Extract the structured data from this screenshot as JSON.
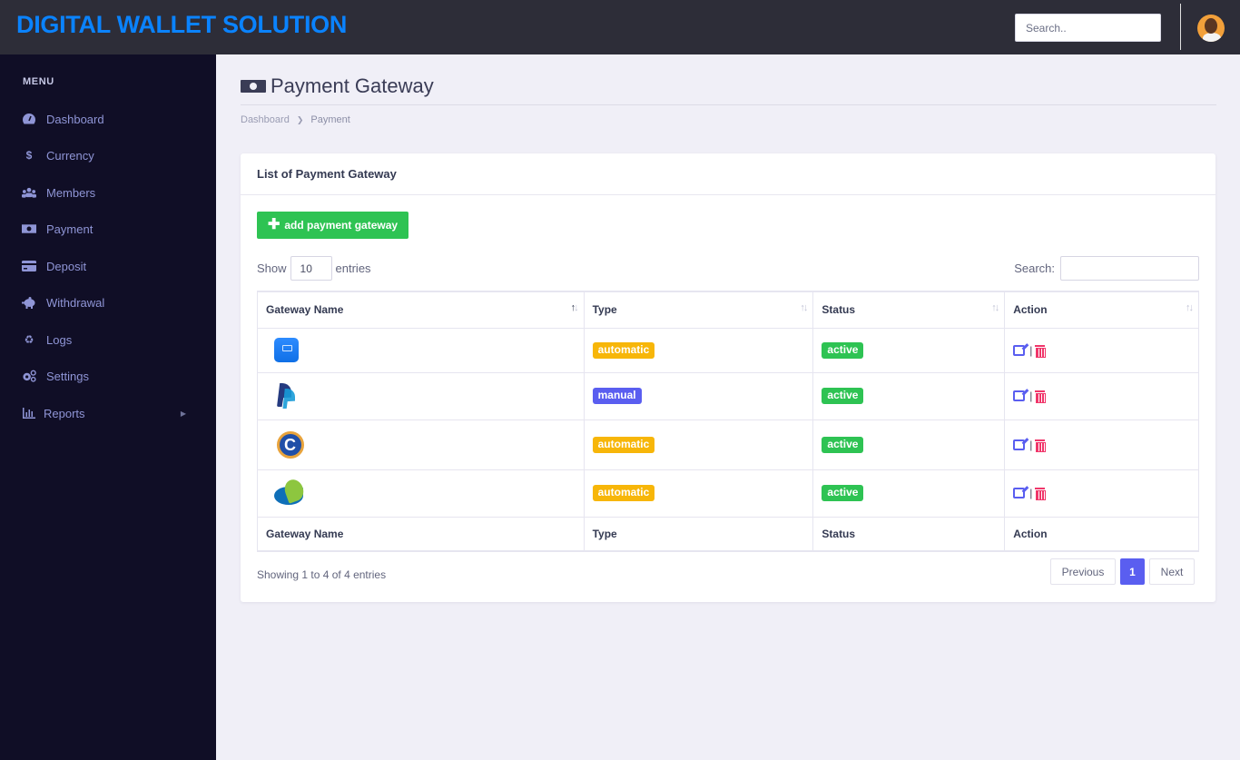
{
  "app": {
    "brand": "DIGITAL WALLET SOLUTION",
    "search_placeholder": "Search..",
    "brand_color": "#0a83ff"
  },
  "sidebar": {
    "menu_title": "MENU",
    "items": [
      {
        "label": "Dashboard",
        "icon": "tachometer-icon"
      },
      {
        "label": "Currency",
        "icon": "dollar-icon"
      },
      {
        "label": "Members",
        "icon": "users-icon"
      },
      {
        "label": "Payment",
        "icon": "money-bill-icon"
      },
      {
        "label": "Deposit",
        "icon": "credit-card-icon"
      },
      {
        "label": "Withdrawal",
        "icon": "piggy-bank-icon"
      },
      {
        "label": "Logs",
        "icon": "recycle-icon"
      },
      {
        "label": "Settings",
        "icon": "cogs-icon"
      },
      {
        "label": "Reports",
        "icon": "bar-chart-icon",
        "has_submenu": true
      }
    ]
  },
  "page": {
    "title": "Payment Gateway",
    "breadcrumb": [
      "Dashboard",
      "Payment"
    ]
  },
  "card": {
    "title": "List of Payment Gateway",
    "add_button": "add payment gateway",
    "show_label": "Show",
    "entries_label": "entries",
    "page_length": "10",
    "search_label": "Search:",
    "search_value": ""
  },
  "table": {
    "columns": [
      "Gateway Name",
      "Type",
      "Status",
      "Action"
    ],
    "rows": [
      {
        "logo": "ocash-logo",
        "type": "automatic",
        "status": "active"
      },
      {
        "logo": "paypal-logo",
        "type": "manual",
        "status": "active"
      },
      {
        "logo": "coin-c-logo",
        "type": "automatic",
        "status": "active"
      },
      {
        "logo": "leaf-logo",
        "type": "automatic",
        "status": "active"
      }
    ],
    "info": "Showing 1 to 4 of 4 entries",
    "pagination": {
      "previous": "Previous",
      "current": "1",
      "next": "Next"
    }
  },
  "colors": {
    "automatic": "#f7b609",
    "manual": "#5a5ef0",
    "active": "#2ec353",
    "edit": "#5a5ef0",
    "delete": "#f0366a"
  }
}
